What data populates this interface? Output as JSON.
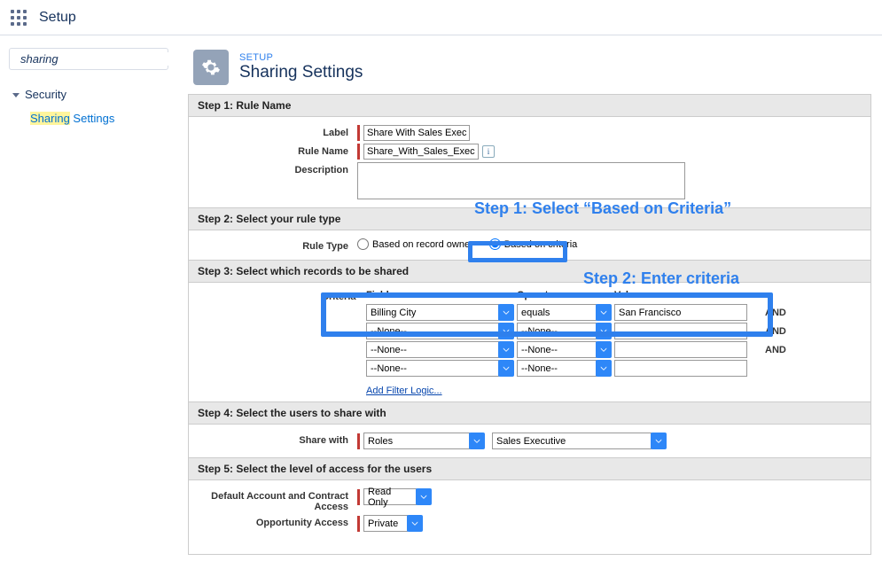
{
  "topbar": {
    "title": "Setup"
  },
  "sidebar": {
    "search_value": "sharing",
    "nav_parent": "Security",
    "nav_child_prefix": "Sharing",
    "nav_child_suffix": " Settings"
  },
  "header": {
    "breadcrumb": "SETUP",
    "title": "Sharing Settings"
  },
  "steps": {
    "s1_title": "Step 1: Rule Name",
    "s2_title": "Step 2: Select your rule type",
    "s3_title": "Step 3: Select which records to be shared",
    "s4_title": "Step 4: Select the users to share with",
    "s5_title": "Step 5: Select the level of access for the users"
  },
  "labels": {
    "label": "Label",
    "rule_name": "Rule Name",
    "description": "Description",
    "rule_type": "Rule Type",
    "criteria": "Criteria",
    "field": "Field",
    "operator": "Operator",
    "value": "Value",
    "and": "AND",
    "share_with": "Share with",
    "default_account": "Default Account and Contract Access",
    "opportunity_access": "Opportunity Access",
    "add_filter": "Add Filter Logic..."
  },
  "values": {
    "label_val": "Share With Sales Exec",
    "rule_name_val": "Share_With_Sales_Exec",
    "info_i": "i",
    "radio_owner": "Based on record owner",
    "radio_criteria": "Based on criteria",
    "none": "--None--",
    "row1_field": "Billing City",
    "row1_op": "equals",
    "row1_val": "San Francisco",
    "share_with_type": "Roles",
    "share_with_target": "Sales Executive",
    "account_access": "Read Only",
    "opp_access": "Private"
  },
  "annotations": {
    "step1": "Step 1: Select “Based on Criteria”",
    "step2": "Step 2: Enter criteria"
  }
}
